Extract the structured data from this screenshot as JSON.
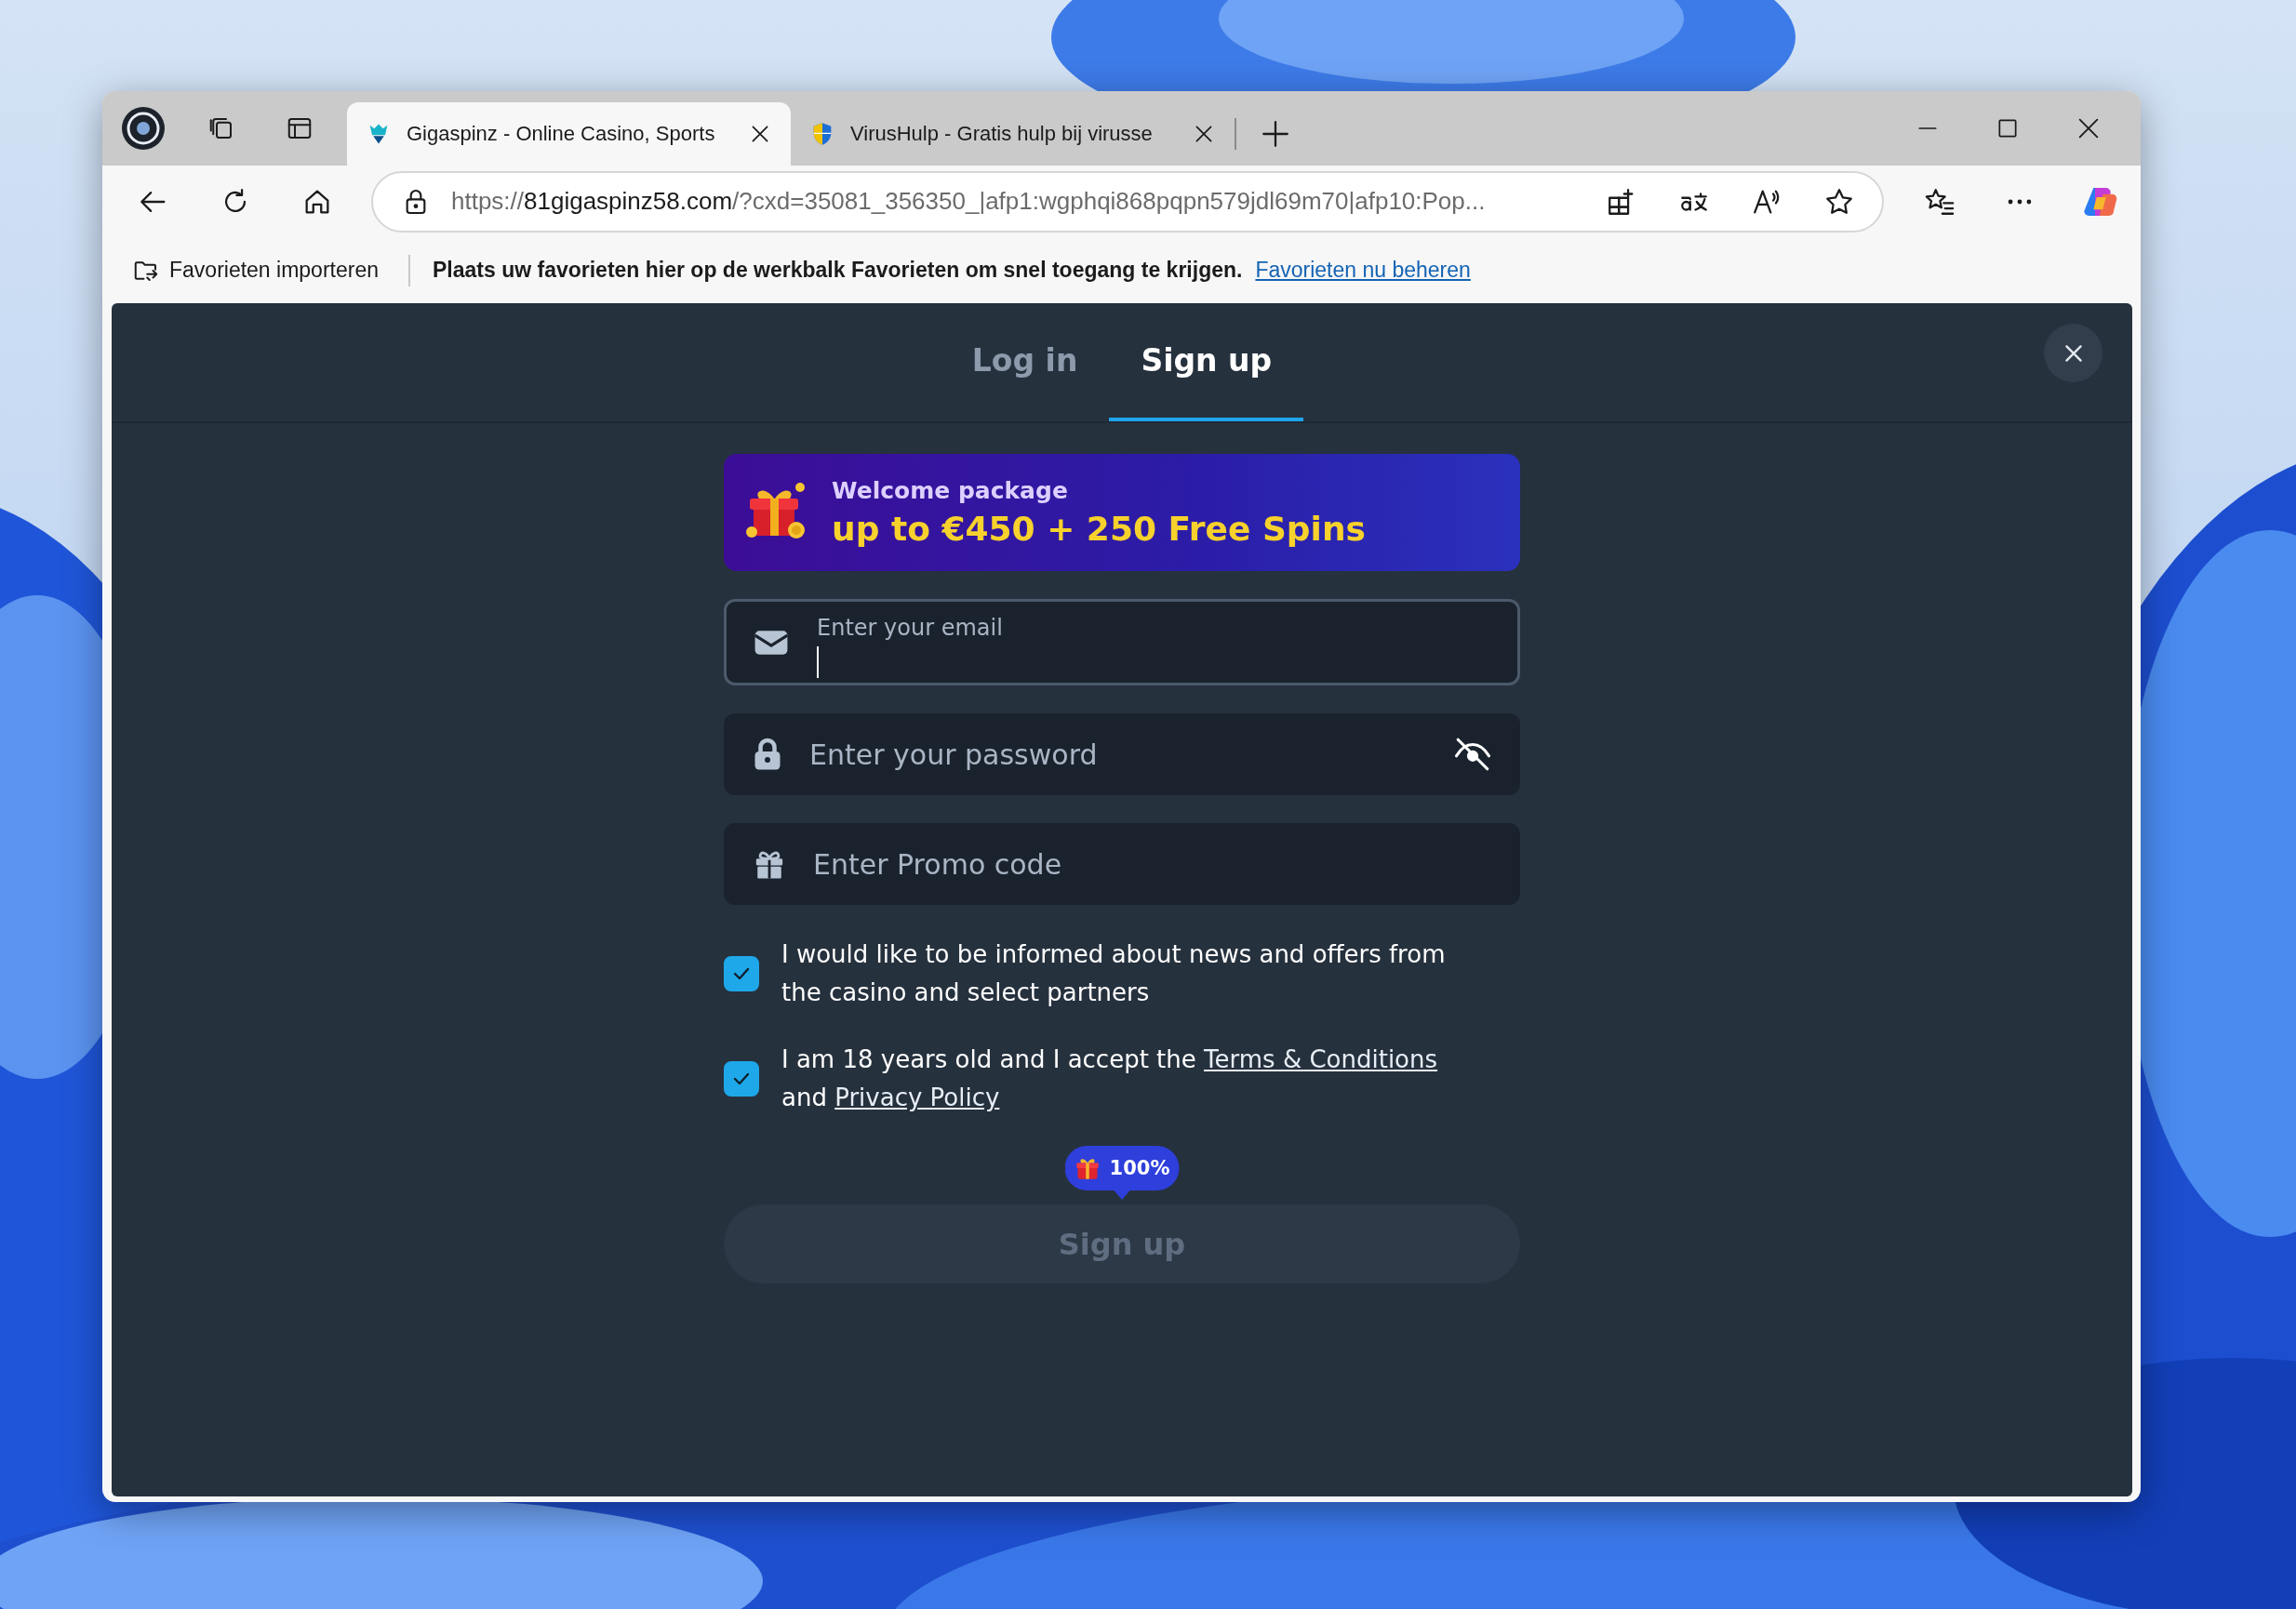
{
  "browser": {
    "tabs": [
      {
        "title": "Gigaspinz - Online Casino, Sports",
        "selected": true
      },
      {
        "title": "VirusHulp - Gratis hulp bij virusse",
        "selected": false
      }
    ],
    "address": {
      "scheme": "https://",
      "host": "81gigaspinz58.com",
      "rest": "/?cxd=35081_356350_|afp1:wgphqi868pqpn579jdl69m70|afp10:Pop..."
    },
    "favorites_bar": {
      "import": "Favorieten importeren",
      "message": "Plaats uw favorieten hier op de werkbalk Favorieten om snel toegang te krijgen.",
      "link": "Favorieten nu beheren"
    }
  },
  "auth_modal": {
    "tabs": [
      {
        "label": "Log in",
        "selected": false
      },
      {
        "label": "Sign up",
        "selected": true
      }
    ],
    "banner": {
      "title": "Welcome package",
      "offer": "up to €450 + 250 Free Spins"
    },
    "fields": [
      {
        "kind": "email",
        "placeholder": "Enter your email",
        "focused": true
      },
      {
        "kind": "password",
        "placeholder": "Enter your password",
        "focused": false
      },
      {
        "kind": "promo",
        "placeholder": "Enter Promo code",
        "focused": false
      }
    ],
    "consents": [
      {
        "checked": true,
        "parts": [
          {
            "kind": "text",
            "text": "I would like to be informed about news and offers from the casino and select partners"
          }
        ]
      },
      {
        "checked": true,
        "parts": [
          {
            "kind": "text",
            "text": "I am 18 years old and I accept the "
          },
          {
            "kind": "link",
            "text": "Terms & Conditions"
          },
          {
            "kind": "text",
            "text": " and "
          },
          {
            "kind": "link",
            "text": "Privacy Policy"
          }
        ]
      }
    ],
    "bonus_badge": "100%",
    "submit": {
      "label": "Sign up",
      "disabled": true
    }
  }
}
